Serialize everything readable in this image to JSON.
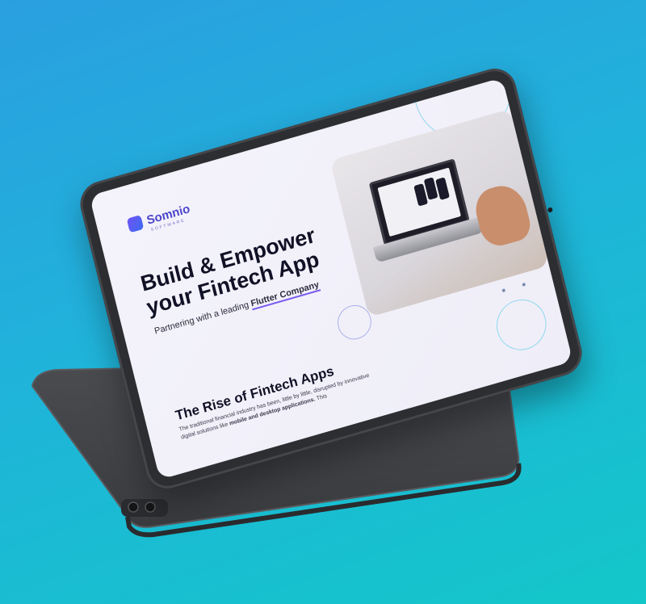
{
  "colors": {
    "background_start": "#2a9fe0",
    "background_end": "#13c7c9",
    "tablet_body": "#2d2e31",
    "accent": "#5b4ee6"
  },
  "brand": {
    "name": "Somnio",
    "tagline": "SOFTWARE"
  },
  "hero": {
    "title": "Build & Empower your Fintech App",
    "subtitle_prefix": "Partnering with a leading ",
    "subtitle_highlight": "Flutter Company"
  },
  "section": {
    "title": "The Rise of Fintech Apps",
    "body_prefix": "The traditional financial industry has been, little by little, disrupted by innovative digital solutions like ",
    "body_highlight": "mobile and desktop applications.",
    "body_suffix": " This"
  },
  "icons": [
    "logo-mark-icon",
    "camera-icon"
  ]
}
